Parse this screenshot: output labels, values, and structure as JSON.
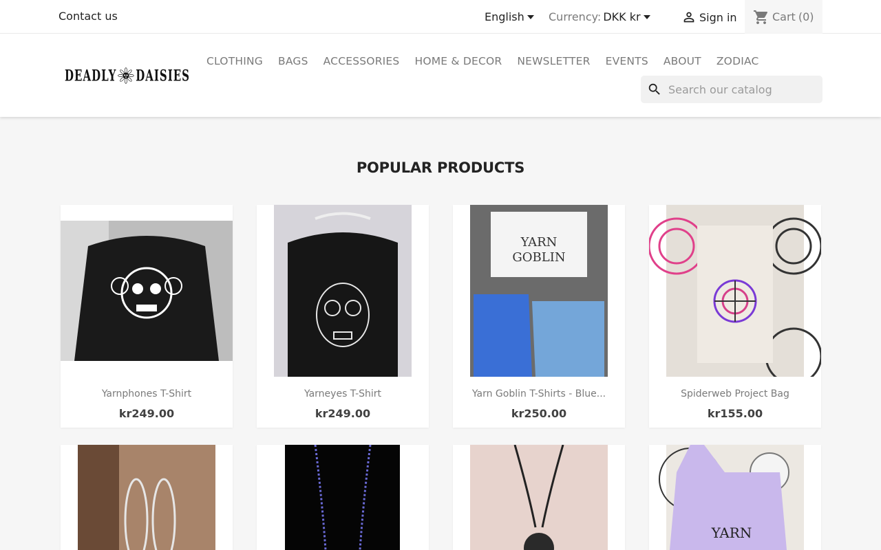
{
  "topbar": {
    "contact": "Contact us",
    "language": "English",
    "currency_label": "Currency:",
    "currency_value": "DKK kr",
    "signin": "Sign in",
    "cart_label": "Cart",
    "cart_count": "(0)"
  },
  "brand": {
    "left_word": "DEADLY",
    "right_word": "DAISIES"
  },
  "nav": [
    "CLOTHING",
    "BAGS",
    "ACCESSORIES",
    "HOME & DECOR",
    "NEWSLETTER",
    "EVENTS",
    "ABOUT",
    "ZODIAC"
  ],
  "search": {
    "placeholder": "Search our catalog"
  },
  "section_title": "POPULAR PRODUCTS",
  "products": [
    {
      "name": "Yarnphones T-Shirt",
      "price": "kr249.00"
    },
    {
      "name": "Yarneyes T-Shirt",
      "price": "kr249.00"
    },
    {
      "name": "Yarn Goblin T-Shirts - Blue...",
      "price": "kr250.00"
    },
    {
      "name": "Spiderweb Project Bag",
      "price": "kr155.00"
    }
  ],
  "colors": {
    "accent": "#24b9d7",
    "text": "#232323",
    "muted": "#7a7a7a",
    "background": "#f6f6f6"
  }
}
